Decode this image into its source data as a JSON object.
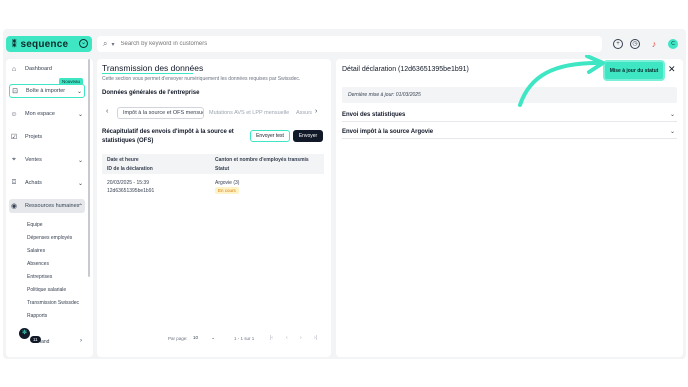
{
  "colors": {
    "accent": "#3ee6c4",
    "dark": "#111827",
    "status_pending": "#d97706"
  },
  "brand": {
    "name": "sequence",
    "logo_icon": "sequence-logo-icon"
  },
  "search": {
    "placeholder": "Search by keyword in customers"
  },
  "topbar_icons": [
    "add-icon",
    "history-icon",
    "bell-icon",
    "avatar-icon"
  ],
  "avatar": {
    "initial": "C"
  },
  "sidebar": {
    "items": [
      {
        "label": "Dashboard",
        "icon": "home-icon"
      },
      {
        "label": "Boîte à importer",
        "icon": "inbox-icon",
        "badge": "Nouveau"
      },
      {
        "label": "Mon espace",
        "icon": "user-icon"
      },
      {
        "label": "Projets",
        "icon": "check-square-icon"
      },
      {
        "label": "Ventes",
        "icon": "tag-icon"
      },
      {
        "label": "Achats",
        "icon": "bag-icon"
      },
      {
        "label": "Ressources humaines",
        "icon": "people-icon"
      }
    ],
    "sub_items": [
      "Equipe",
      "Dépenses employés",
      "Salaires",
      "Absences",
      "Entreprises",
      "Politique salariale",
      "Transmission Swissdec",
      "Rapports"
    ],
    "bottom": {
      "count": "11",
      "location": "Zurich",
      "location_suffix": "land"
    }
  },
  "main": {
    "title": "Transmission des données",
    "description": "Cette section vous permet d'envoyer numériquement les données requises par Swissdec.",
    "section_title": "Données générales de l'entreprise",
    "tabs": [
      "Impôt à la source et OFS mensuel",
      "Mutations AVS et LPP mensuelles",
      "Assura"
    ],
    "recap_title": "Récapitulatif des envois d'impôt à la source et statistiques (OFS)",
    "btn_test": "Envoyer test",
    "btn_send": "Envoyer",
    "table": {
      "headers": [
        "Date et heure",
        "ID de la déclaration",
        "Canton et nombre d'employés transmis",
        "Statut"
      ],
      "rows": [
        {
          "date": "20/03/2025 - 15:39",
          "id": "12d63651395be1b91",
          "canton": "Argovie (3)",
          "status": "En cours"
        }
      ]
    },
    "pager": {
      "per_page_label": "Par page:",
      "per_page_value": "10",
      "range": "1 - 1 sur 1"
    }
  },
  "detail": {
    "title": "Détail déclaration (12d63651395be1b91)",
    "update_button": "Mise à jour du statut",
    "last_update": "Dernière mise à jour: 01/03/2025",
    "accordions": [
      "Envoi des statistiques",
      "Envoi impôt à la source Argovie"
    ]
  }
}
